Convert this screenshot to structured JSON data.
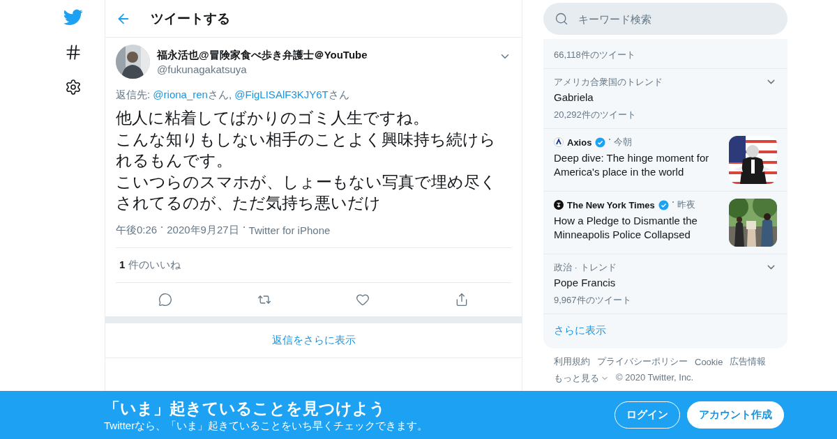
{
  "nav": {
    "items": [
      {
        "kind": "logo"
      },
      {
        "kind": "explore"
      },
      {
        "kind": "settings"
      }
    ]
  },
  "header": {
    "title": "ツイートする"
  },
  "tweet": {
    "author": {
      "name": "福永活也@冒険家食べ歩き弁護士＠YouTube",
      "handle": "@fukunagakatsuya"
    },
    "reply_to": [
      {
        "text": "返信先: ",
        "kind": "plain"
      },
      {
        "text": "@riona_ren",
        "kind": "link"
      },
      {
        "text": "さん, ",
        "kind": "plain"
      },
      {
        "text": "@FigLISAlF3KJY6T",
        "kind": "link"
      },
      {
        "text": "さん",
        "kind": "plain"
      }
    ],
    "lines": [
      "他人に粘着してばかりのゴミ人生ですね。",
      "こんな知りもしない相手のことよく興味持ち続けら",
      "れるもんです。",
      "こいつらのスマホが、しょーもない写真で埋め尽く",
      "されてるのが、ただ気持ち悪いだけ"
    ],
    "meta": [
      "午後0:26",
      "2020年9月27日",
      "Twitter for iPhone"
    ],
    "likes": "**1** 件のいいね",
    "actions": [
      {
        "kind": "reply"
      },
      {
        "kind": "retweet"
      },
      {
        "kind": "like"
      },
      {
        "kind": "share"
      }
    ]
  },
  "more_replies": "返信をさらに表示",
  "search": {
    "placeholder": "キーワード検索"
  },
  "trends": [
    {
      "kind": "trend",
      "count": "66,118件のツイート"
    },
    {
      "kind": "trend",
      "context": "アメリカ合衆国のトレンド",
      "title": "Gabriela",
      "count": "20,292件のツイート"
    },
    {
      "kind": "news",
      "source": "Axios",
      "logo": {
        "kind": "axios"
      },
      "time": "今朝",
      "headline": "Deep dive: The hinge moment for America's place in the world",
      "thumb": {
        "kind": "flag"
      }
    },
    {
      "kind": "news",
      "source": "The New York Times",
      "logo": {
        "kind": "nyt"
      },
      "time": "昨夜",
      "headline": "How a Pledge to Dismantle the Minneapolis Police Collapsed",
      "thumb": {
        "kind": "crowd"
      }
    },
    {
      "kind": "trend",
      "context": "政治 · トレンド",
      "title": "Pope Francis",
      "count": "9,967件のツイート"
    }
  ],
  "trends_more": "さらに表示",
  "footer": {
    "links": [
      "利用規約",
      "プライバシーポリシー",
      "Cookie",
      "広告情報"
    ],
    "more": "もっと見る",
    "copyright": "© 2020 Twitter, Inc."
  },
  "banner": {
    "title": "「いま」起きていることを見つけよう",
    "subtitle": "Twitterなら、「いま」起きていることをいち早くチェックできます。",
    "login": "ログイン",
    "signup": "アカウント作成"
  }
}
